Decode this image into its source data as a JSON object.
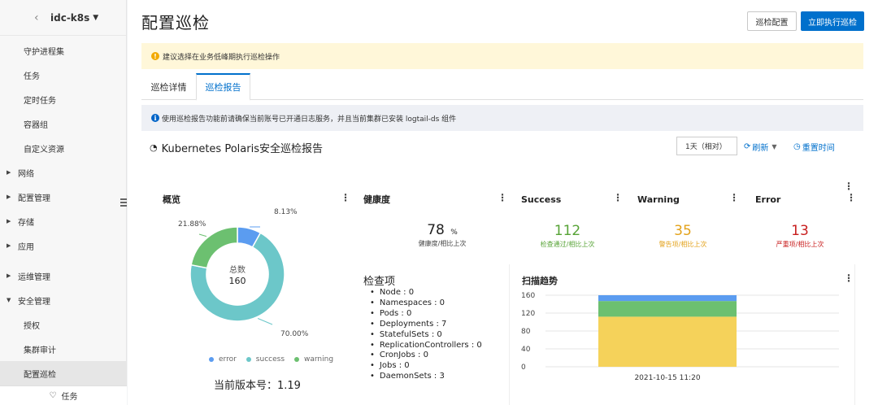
{
  "sidebar": {
    "cluster_name": "idc-k8s",
    "items": [
      {
        "label": "守护进程集",
        "type": "sub"
      },
      {
        "label": "任务",
        "type": "sub"
      },
      {
        "label": "定时任务",
        "type": "sub"
      },
      {
        "label": "容器组",
        "type": "sub"
      },
      {
        "label": "自定义资源",
        "type": "sub"
      },
      {
        "label": "网络",
        "type": "group"
      },
      {
        "label": "配置管理",
        "type": "group"
      },
      {
        "label": "存储",
        "type": "group"
      },
      {
        "label": "应用",
        "type": "group"
      },
      {
        "label": "运维管理",
        "type": "group"
      },
      {
        "label": "安全管理",
        "type": "group-open"
      },
      {
        "label": "授权",
        "type": "sub"
      },
      {
        "label": "集群审计",
        "type": "sub"
      },
      {
        "label": "配置巡检",
        "type": "sub-active"
      }
    ],
    "bottom_label": "任务"
  },
  "header": {
    "title": "配置巡检",
    "config_button": "巡检配置",
    "run_button": "立即执行巡检"
  },
  "alerts": {
    "warning": "建议选择在业务低峰期执行巡检操作",
    "info": "使用巡检报告功能前请确保当前账号已开通日志服务，并且当前集群已安装 logtail-ds 组件"
  },
  "tabs": [
    {
      "label": "巡检详情",
      "active": false
    },
    {
      "label": "巡检报告",
      "active": true
    }
  ],
  "report": {
    "title": "Kubernetes Polaris安全巡检报告",
    "time_range": "1天（相对）",
    "refresh_label": "刷新",
    "reset_label": "重置时间"
  },
  "overview": {
    "title": "概览",
    "center_label": "总数",
    "center_value": "160",
    "version": "当前版本号：1.19"
  },
  "health": {
    "title": "健康度",
    "value": "78",
    "unit": "%",
    "label": "健康度/相比上次"
  },
  "stats": [
    {
      "title": "Success",
      "value": "112",
      "label": "检查通过/相比上次",
      "color": "#57a336"
    },
    {
      "title": "Warning",
      "value": "35",
      "label": "警告项/相比上次",
      "color": "#e3a21a"
    },
    {
      "title": "Error",
      "value": "13",
      "label": "严重项/相比上次",
      "color": "#c81e1e"
    }
  ],
  "checks": {
    "title": "检查项",
    "items": [
      "Node : 0",
      "Namespaces : 0",
      "Pods : 0",
      "Deployments : 7",
      "StatefulSets : 0",
      "ReplicationControllers : 0",
      "CronJobs : 0",
      "Jobs : 0",
      "DaemonSets : 3"
    ]
  },
  "colors": {
    "error": "#5b9cf0",
    "success": "#6cc7c9",
    "warning": "#6cc070",
    "stack_top": "#5b9cf0",
    "stack_mid": "#6cc070",
    "stack_bottom": "#f5d25a",
    "accent": "#0070cc"
  },
  "chart_data": [
    {
      "type": "pie",
      "title": "概览",
      "labels": [
        "error",
        "success",
        "warning"
      ],
      "values": [
        8.13,
        70.0,
        21.88
      ],
      "value_labels": [
        "8.13%",
        "70.00%",
        "21.88%"
      ],
      "legend_position": "bottom"
    },
    {
      "type": "bar",
      "title": "扫描趋势",
      "categories": [
        "2021-10-15 11:20"
      ],
      "series": [
        {
          "values": [
            112
          ]
        },
        {
          "values": [
            35
          ]
        },
        {
          "values": [
            13
          ]
        }
      ],
      "stacked": true,
      "ylim": [
        0,
        160
      ],
      "yticks": [
        "160",
        "120",
        "80",
        "40",
        "0"
      ],
      "grid": true
    }
  ]
}
